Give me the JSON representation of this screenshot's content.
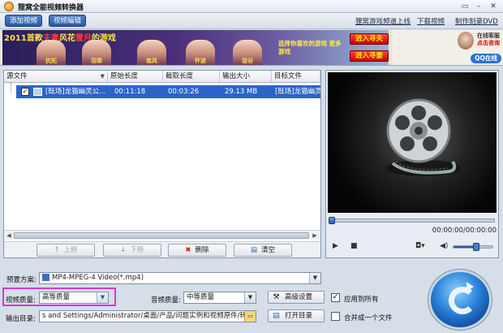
{
  "window": {
    "title": "狸窝全能视频转换器",
    "controls": [
      "▭",
      "–",
      "✕"
    ]
  },
  "toolbar": {
    "add_video": "添加视频",
    "edit_video": "视频编辑",
    "links": [
      "狸窝游戏频道上线",
      "下载视频",
      "制作刻录DVD"
    ]
  },
  "banner": {
    "headline_pre": "2011首款",
    "headline_red1": "夫妻",
    "headline_mid": "风花",
    "headline_red2": "雪月",
    "headline_post": "的游戏",
    "characters": [
      "抗拓",
      "羽翠",
      "南风",
      "怀波",
      "珑谷"
    ],
    "promo_text": "选择你喜欢的游戏 更多游戏",
    "btn_wife": "进入寻夫",
    "btn_husband": "进入寻妻",
    "support_line1": "在线客服",
    "support_line2": "点击咨询",
    "support_qq": "QQ在线"
  },
  "file_list": {
    "columns": [
      "源文件",
      "原始长度",
      "截取长度",
      "输出大小",
      "目标文件"
    ],
    "rows": [
      {
        "checked": true,
        "source": "[既场]龙猫幽灵公...",
        "original_length": "00:11:18",
        "cut_length": "00:03:26",
        "output_size": "29.13 MB",
        "target": "[既场]龙猫幽灵"
      }
    ],
    "buttons": {
      "up": "上移",
      "down": "下移",
      "delete": "删除",
      "clear": "清空"
    }
  },
  "player": {
    "time": "00:00:00/00:00:00",
    "progress": 0,
    "volume": 0.6
  },
  "settings": {
    "preset_label": "预置方案:",
    "preset_value": "MP4-MPEG-4 Video(*.mp4)",
    "video_quality_label": "视频质量:",
    "video_quality_value": "高等质量",
    "audio_quality_label": "音频质量:",
    "audio_quality_value": "中等质量",
    "advanced_button": "高级设置",
    "apply_all_label": "应用到所有",
    "apply_all_checked": true,
    "output_label": "输出目录:",
    "output_path": "s and Settings/Administrator/桌面/产品/问题实例和视频原件/转换",
    "open_dir_button": "打开目录",
    "merge_label": "合并成一个文件",
    "merge_checked": false
  },
  "colors": {
    "selection": "#2d63c8",
    "highlight_box": "#d43ad8",
    "convert_button": "#2a82d8"
  }
}
